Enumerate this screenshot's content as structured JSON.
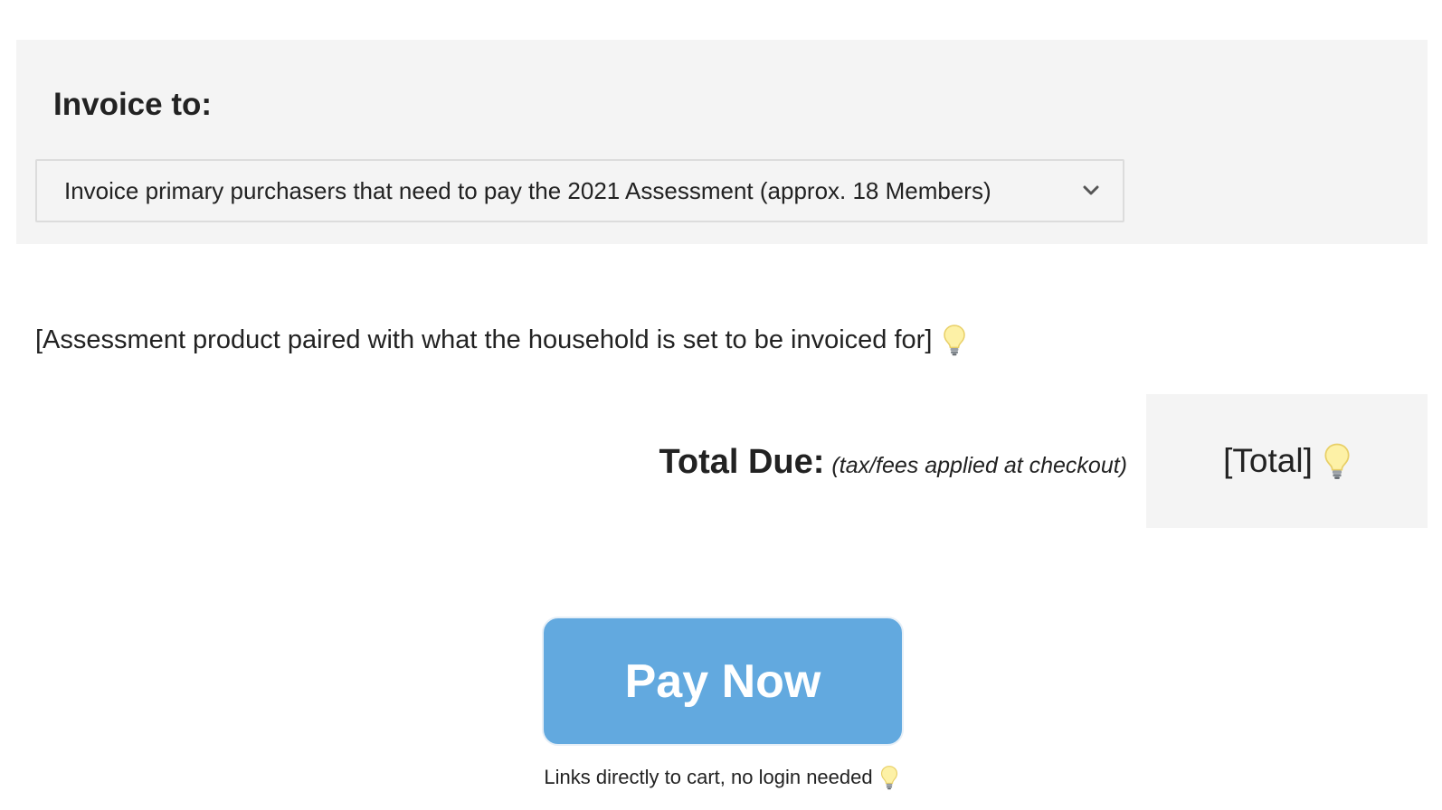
{
  "invoice": {
    "heading": "Invoice to:",
    "selected_option": "Invoice primary purchasers that need to pay the 2021 Assessment (approx. 18 Members)",
    "dropdown_icon": "chevron-down-icon"
  },
  "assessment": {
    "text": "[Assessment product paired with what the household is set to be invoiced for]",
    "hint_icon": "lightbulb-icon"
  },
  "total": {
    "label": "Total Due:",
    "note": "(tax/fees applied at checkout)",
    "value": "[Total]",
    "hint_icon": "lightbulb-icon"
  },
  "pay_button": {
    "label": "Pay Now",
    "color": "#62a9df"
  },
  "cart_note": {
    "text": "Links directly to cart, no login needed",
    "hint_icon": "lightbulb-icon"
  },
  "colors": {
    "panel_background": "#f4f4f4",
    "text": "#222222",
    "button": "#62a9df"
  }
}
